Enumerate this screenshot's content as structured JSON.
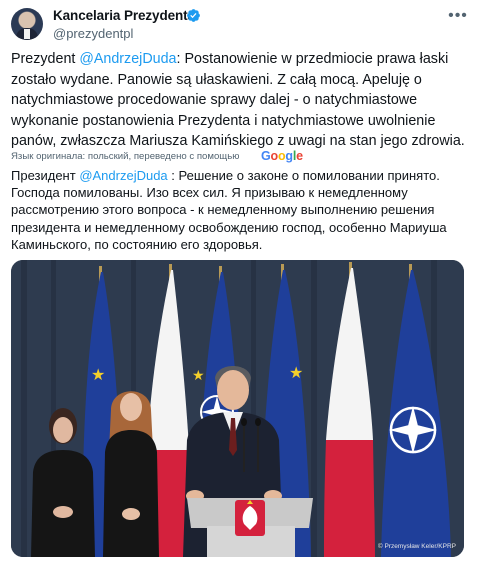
{
  "account": {
    "name": "Kancelaria Prezydenta",
    "handle": "@prezydentpl",
    "verified": true,
    "avatar": "avatar"
  },
  "menu_icon": "more-icon",
  "tweet": {
    "prefix": "Prezydent ",
    "mention": "@AndrzejDuda",
    "body": ": Postanowienie w przedmiocie prawa łaski zostało wydane. Panowie są ułaskawieni. Z całą mocą. Apeluję o natychmiastowe procedowanie sprawy dalej - o natychmiastowe wykonanie postanowienia Prezydenta i natychmiastowe uwolnienie panów, zwłaszcza Mariusza Kamińskiego z uwagi na stan jego zdrowia."
  },
  "translation": {
    "note": "Язык оригинала: польский, переведено с помощью",
    "provider": "Google",
    "prefix": "Президент ",
    "mention": "@AndrzejDuda",
    "body": " : Решение о законе о помиловании принято. Господа помилованы. Изо всех сил. Я призываю к немедленному рассмотрению этого вопроса - к немедленному выполнению решения президента и немедленному освобождению господ, особенно Мариуша Каминьского, по состоянию его здоровья."
  },
  "photo": {
    "credit": "© Przemysław Keler/KPRP",
    "colors": {
      "eu_blue": "#1f3f9a",
      "poland_red": "#d4213d",
      "poland_white": "#f4f4f4",
      "curtain": "#2e3b4f"
    }
  },
  "colors": {
    "link": "#1d9bf0",
    "secondary_text": "#536471",
    "verified": "#1d9bf0"
  }
}
